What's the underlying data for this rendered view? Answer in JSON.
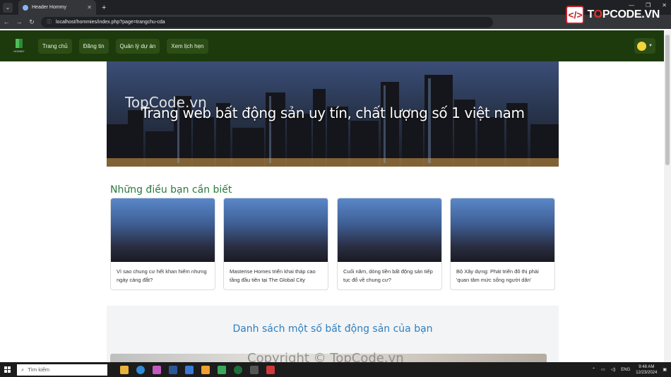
{
  "browser": {
    "tab_title": "Header Hommy",
    "url": "localhost/hommies/index.php?page=trangchu-cda"
  },
  "brand_overlay": {
    "prefix": "T",
    "accent": "O",
    "rest": "PCODE.VN"
  },
  "header": {
    "logo_text": "HOMMY",
    "nav": [
      {
        "label": "Trang chủ"
      },
      {
        "label": "Đăng tin"
      },
      {
        "label": "Quản lý dự án"
      },
      {
        "label": "Xem lịch hẹn"
      }
    ]
  },
  "hero": {
    "title": "Trang web bất động sản uy tín, chất lượng số 1 việt nam",
    "watermark": "TopCode.vn"
  },
  "section": {
    "title": "Những điều bạn cần biết",
    "cards": [
      {
        "text": "Vì sao chung cư hết khan hiếm nhưng ngày càng đắt?"
      },
      {
        "text": "Masterise Homes triển khai tháp cao tầng đầu tiên tại The Global City"
      },
      {
        "text": "Cuối năm, dòng tiền bất động sản tiếp tục đổ về chung cư?"
      },
      {
        "text": "Bộ Xây dựng: Phát triển đô thị phải 'quan tâm mức sống người dân'"
      }
    ]
  },
  "listing": {
    "title": "Danh sách một số bất động sản của bạn"
  },
  "footer_watermark": "Copyright © TopCode.vn",
  "taskbar": {
    "search_placeholder": "Tìm kiếm",
    "lang": "ENG",
    "time": "9:48 AM",
    "date": "12/23/2024"
  },
  "colors": {
    "header_bg": "#1d3a0c",
    "section_title": "#2a7a3b",
    "listing_title": "#2f7fbf"
  }
}
